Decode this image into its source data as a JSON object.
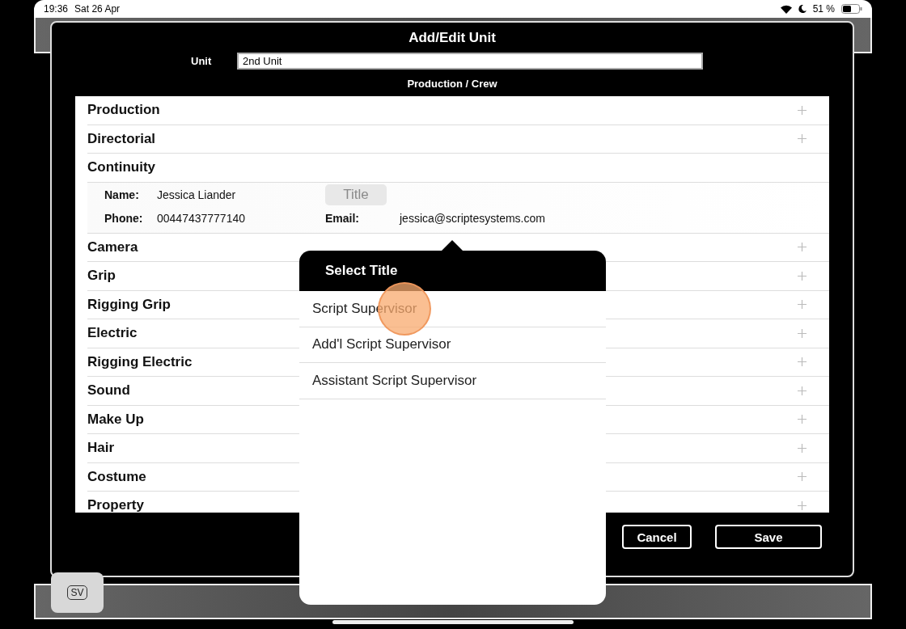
{
  "status_bar": {
    "time": "19:36",
    "date": "Sat 26 Apr",
    "battery": "51 %"
  },
  "dialog": {
    "title": "Add/Edit Unit",
    "unit_label": "Unit",
    "unit_value": "2nd Unit",
    "section": "Production / Crew",
    "departments": [
      {
        "name": "Production",
        "expanded": false
      },
      {
        "name": "Directorial",
        "expanded": false
      },
      {
        "name": "Continuity",
        "expanded": true,
        "contact": {
          "name_label": "Name:",
          "name": "Jessica Liander",
          "title_button": "Title",
          "title_disabled": true,
          "phone_label": "Phone:",
          "phone": "00447437777140",
          "email_label": "Email:",
          "email": "jessica@scriptesystems.com"
        }
      },
      {
        "name": "Camera",
        "expanded": false
      },
      {
        "name": "Grip",
        "expanded": false
      },
      {
        "name": "Rigging Grip",
        "expanded": false
      },
      {
        "name": "Electric",
        "expanded": false
      },
      {
        "name": "Rigging Electric",
        "expanded": false
      },
      {
        "name": "Sound",
        "expanded": false
      },
      {
        "name": "Make Up",
        "expanded": false
      },
      {
        "name": "Hair",
        "expanded": false
      },
      {
        "name": "Costume",
        "expanded": false
      },
      {
        "name": "Property",
        "expanded": false
      }
    ],
    "buttons": [
      "Cancel",
      "Save"
    ]
  },
  "popover": {
    "title": "Select Title",
    "options": [
      {
        "label": "Script Supervisor",
        "pressed": true
      },
      {
        "label": "Add'l Script Supervisor",
        "pressed": false
      },
      {
        "label": "Assistant Script Supervisor",
        "pressed": false
      }
    ]
  },
  "dock_button": {
    "label": "SV"
  }
}
